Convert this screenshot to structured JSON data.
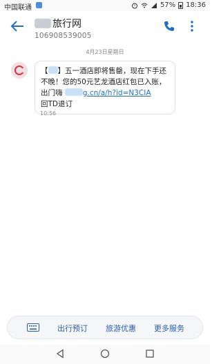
{
  "status_bar": {
    "carrier": "中国联通",
    "battery_percent": "57%",
    "time": "18:36"
  },
  "header": {
    "title": "旅行网",
    "subtitle": "106908539005"
  },
  "conversation": {
    "date": "4月23日星期日",
    "message": {
      "part1": "【",
      "part2": "】五一酒店即将售罄，现在下手还不晚！您的50元艺龙酒店红包已入账，出门嗨 ",
      "link_visible": "g.cn/a/h?id=N3CIA",
      "part3": "回TD退订"
    },
    "time": "10:56"
  },
  "menu_bar": {
    "items": [
      "出行预订",
      "旅游优惠",
      "更多服务"
    ]
  },
  "icons": {
    "back": "back-arrow-icon",
    "phone": "phone-icon",
    "more": "more-vertical-icon",
    "keyboard": "keyboard-icon",
    "avatar": "avatar-icon"
  },
  "colors": {
    "accent": "#1f6fc9",
    "menu_text": "#2a5db0"
  }
}
